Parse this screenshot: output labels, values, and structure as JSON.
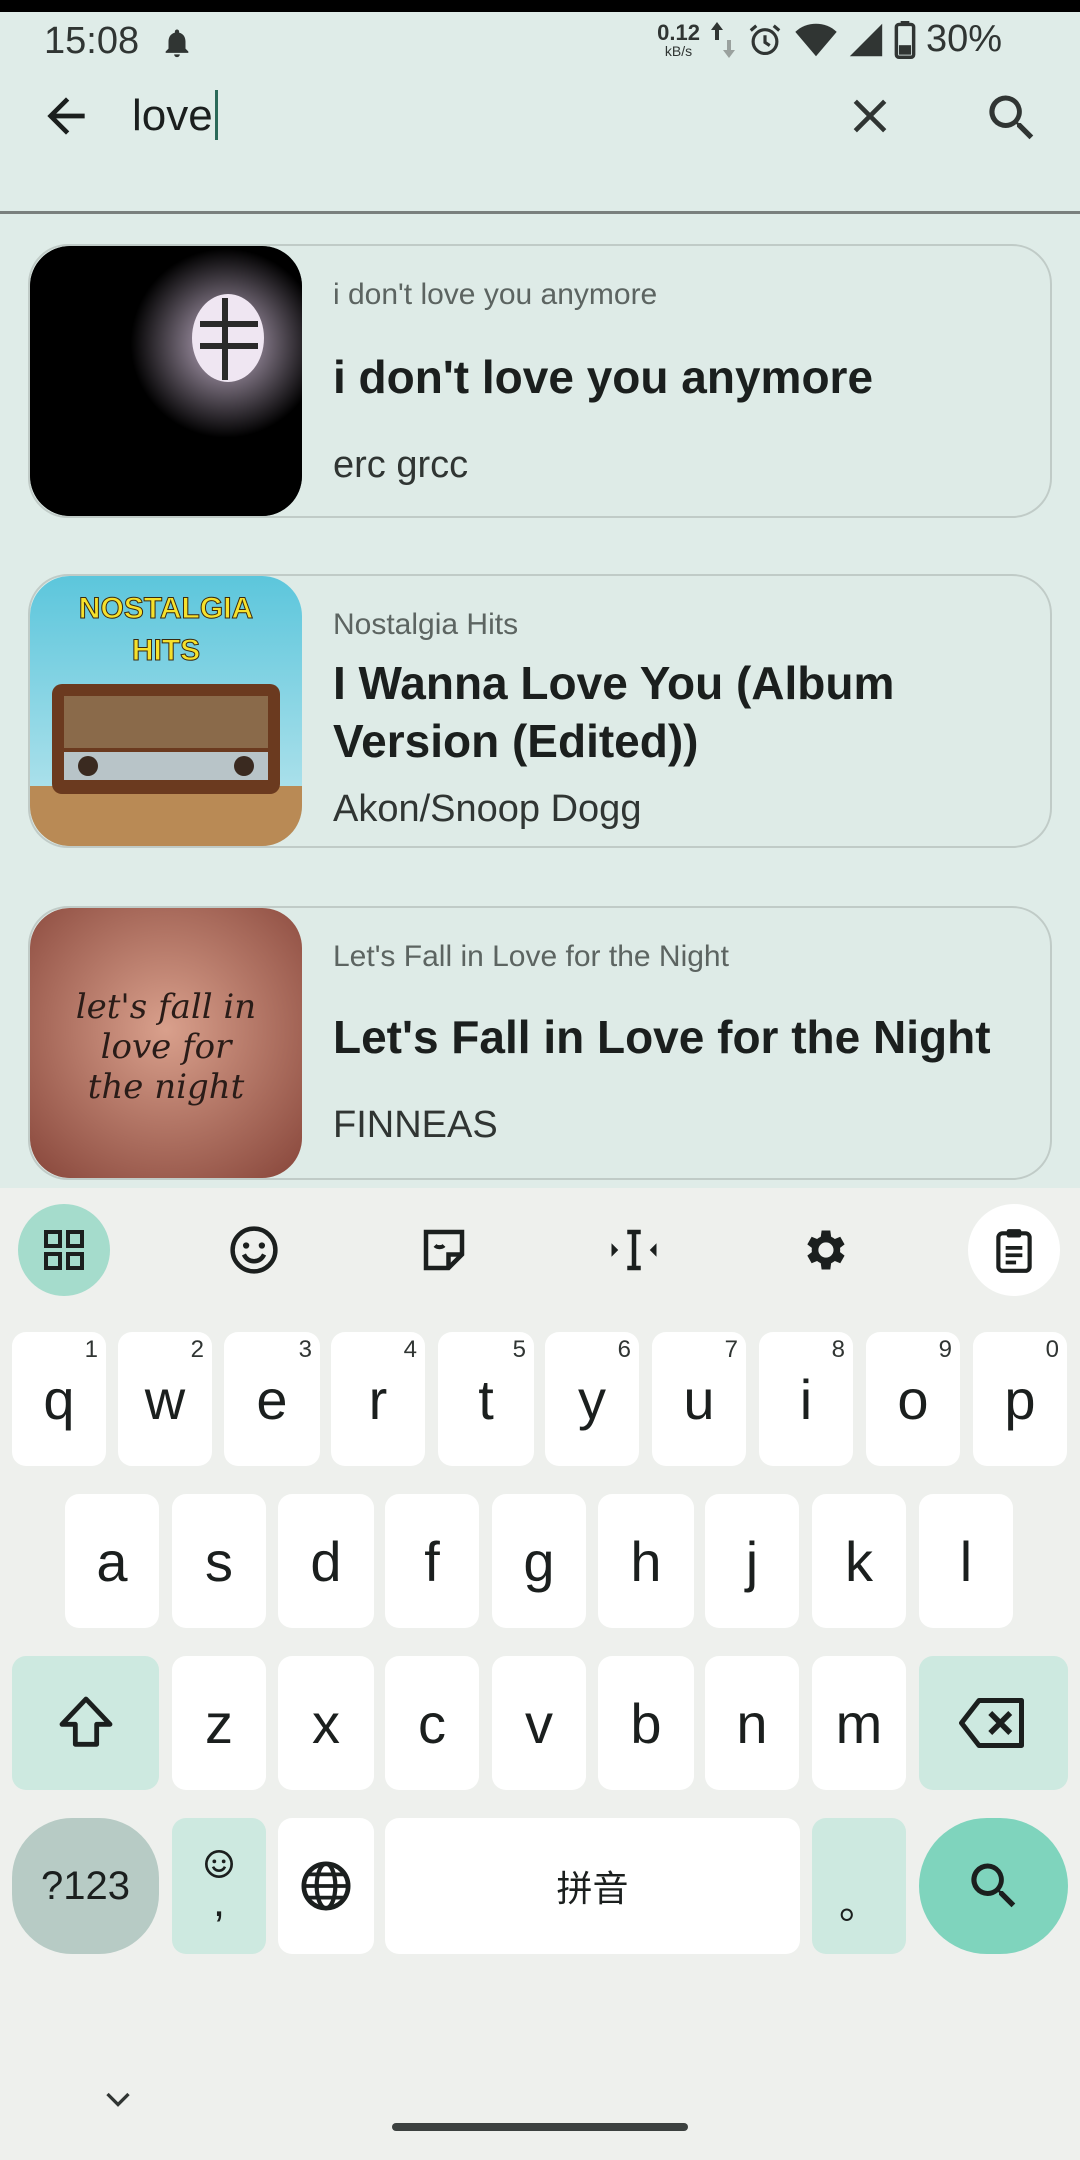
{
  "status_bar": {
    "time": "15:08",
    "net_speed": "0.12",
    "net_unit": "kB/s",
    "battery": "30%"
  },
  "search": {
    "query": "love"
  },
  "results": [
    {
      "album": "i don't love you anymore",
      "title": "i don't love you anymore",
      "artist": "erc grcc"
    },
    {
      "album": "Nostalgia Hits",
      "title": "I Wanna Love You (Album Version (Edited))",
      "artist": "Akon/Snoop Dogg",
      "art_text": "NOSTALGIA HITS"
    },
    {
      "album": "Let's Fall in Love for the Night",
      "title": "Let's Fall in Love for the Night",
      "artist": "FINNEAS",
      "art_text": "let's fall in love for the night"
    }
  ],
  "keyboard": {
    "row1": [
      {
        "k": "q",
        "h": "1"
      },
      {
        "k": "w",
        "h": "2"
      },
      {
        "k": "e",
        "h": "3"
      },
      {
        "k": "r",
        "h": "4"
      },
      {
        "k": "t",
        "h": "5"
      },
      {
        "k": "y",
        "h": "6"
      },
      {
        "k": "u",
        "h": "7"
      },
      {
        "k": "i",
        "h": "8"
      },
      {
        "k": "o",
        "h": "9"
      },
      {
        "k": "p",
        "h": "0"
      }
    ],
    "row2": [
      "a",
      "s",
      "d",
      "f",
      "g",
      "h",
      "j",
      "k",
      "l"
    ],
    "row3": [
      "z",
      "x",
      "c",
      "v",
      "b",
      "n",
      "m"
    ],
    "symbols_label": "?123",
    "comma_label": ",",
    "space_label": "拼音",
    "period_label": "。"
  },
  "colors": {
    "background": "#dfece8",
    "accent": "#7fd4bd",
    "active_tool": "#a5dccc"
  }
}
